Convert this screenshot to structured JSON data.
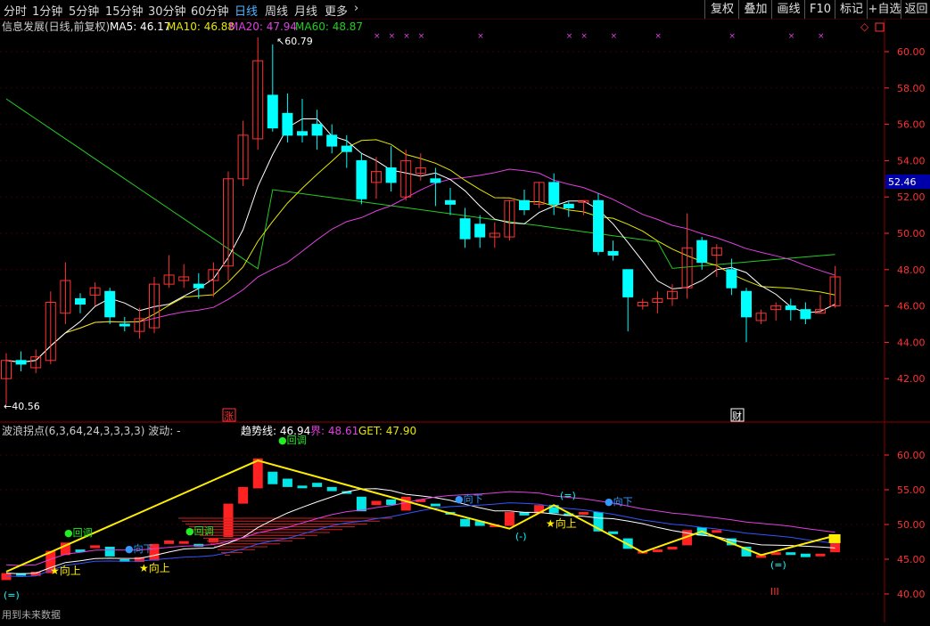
{
  "periods": [
    {
      "label": "分时",
      "active": false
    },
    {
      "label": "1分钟",
      "active": false
    },
    {
      "label": "5分钟",
      "active": false
    },
    {
      "label": "15分钟",
      "active": false
    },
    {
      "label": "30分钟",
      "active": false
    },
    {
      "label": "60分钟",
      "active": false
    },
    {
      "label": "日线",
      "active": true
    },
    {
      "label": "周线",
      "active": false
    },
    {
      "label": "月线",
      "active": false
    },
    {
      "label": "更多",
      "active": false
    }
  ],
  "more_chevron": "›",
  "tools": [
    "复权",
    "叠加",
    "画线",
    "F10",
    "标记",
    "+自选",
    "返回"
  ],
  "main": {
    "title": "信息发展(日线,前复权)",
    "ma5_label": "MA5: 46.17",
    "ma10_label": "MA10: 46.88",
    "ma20_label": "MA20: 47.94",
    "ma60_label": "MA60: 48.87",
    "high_label": "60.79",
    "low_label": "40.56",
    "current_price": "52.46",
    "zhang_marker": "涨",
    "cai_marker": "财",
    "price_axis": [
      "60.00",
      "58.00",
      "56.00",
      "54.00",
      "52.00",
      "50.00",
      "48.00",
      "46.00",
      "44.00",
      "42.00"
    ],
    "x_marker": "×",
    "colors": {
      "ma5": "#ffffff",
      "ma10": "#e6e600",
      "ma20": "#e040e0",
      "ma60": "#22cc22",
      "up": "#ff3333",
      "down": "#00ffff",
      "axis": "#ff3333"
    }
  },
  "sub": {
    "title": "波浪拐点(6,3,64,24,3,3,3,3) 波动: -",
    "trend_label": "趋势线: 46.94",
    "jie_label": "界: 48.61",
    "get_label": "GET: 47.90",
    "axis": [
      "60.00",
      "55.00",
      "50.00",
      "45.00",
      "40.00"
    ],
    "annotations": {
      "huitiao": "回调",
      "xiangxia": "向下",
      "xiangshang": "向上",
      "circle_2": "(=)",
      "circle_1": "(-)",
      "roman": "III"
    },
    "footer": "用到未来数据"
  },
  "chart_data": {
    "type": "candlestick",
    "price_high": 60.79,
    "price_low": 40.56,
    "ylim": [
      40.5,
      61.0
    ],
    "candles": [
      [
        42.0,
        43.0,
        43.4,
        40.6
      ],
      [
        43.0,
        42.8,
        43.5,
        42.4
      ],
      [
        42.6,
        43.2,
        43.6,
        42.3
      ],
      [
        43.0,
        46.2,
        46.8,
        42.8
      ],
      [
        45.6,
        47.4,
        48.4,
        45.0
      ],
      [
        46.4,
        46.1,
        46.7,
        45.6
      ],
      [
        46.6,
        47.0,
        47.3,
        46.0
      ],
      [
        46.8,
        45.4,
        47.0,
        45.0
      ],
      [
        45.0,
        44.9,
        45.4,
        44.6
      ],
      [
        44.6,
        45.3,
        45.9,
        44.2
      ],
      [
        44.8,
        47.2,
        47.6,
        44.5
      ],
      [
        47.2,
        47.7,
        48.8,
        47.0
      ],
      [
        47.4,
        47.6,
        48.3,
        47.0
      ],
      [
        47.2,
        47.0,
        47.8,
        46.4
      ],
      [
        47.4,
        48.0,
        48.4,
        46.5
      ],
      [
        48.2,
        53.0,
        53.4,
        47.4
      ],
      [
        53.0,
        55.4,
        56.2,
        52.6
      ],
      [
        55.2,
        59.5,
        60.79,
        54.6
      ],
      [
        57.6,
        55.8,
        60.4,
        55.6
      ],
      [
        56.6,
        55.4,
        57.7,
        55.0
      ],
      [
        55.6,
        55.4,
        57.4,
        55.0
      ],
      [
        56.0,
        55.4,
        56.8,
        54.6
      ],
      [
        55.4,
        54.8,
        56.0,
        54.4
      ],
      [
        54.8,
        54.5,
        55.4,
        53.6
      ],
      [
        54.0,
        51.9,
        54.4,
        51.6
      ],
      [
        52.8,
        53.4,
        54.2,
        51.9
      ],
      [
        53.6,
        52.8,
        54.8,
        52.3
      ],
      [
        52.0,
        54.0,
        54.6,
        51.8
      ],
      [
        53.3,
        53.6,
        54.4,
        52.9
      ],
      [
        53.0,
        52.8,
        53.6,
        51.5
      ],
      [
        51.8,
        51.6,
        52.5,
        51.0
      ],
      [
        50.8,
        49.7,
        51.4,
        49.2
      ],
      [
        50.5,
        49.8,
        51.0,
        49.2
      ],
      [
        49.8,
        50.0,
        50.6,
        49.2
      ],
      [
        49.8,
        51.8,
        51.8,
        49.6
      ],
      [
        51.8,
        51.3,
        52.4,
        51.0
      ],
      [
        51.6,
        52.8,
        52.8,
        51.4
      ],
      [
        52.8,
        51.6,
        53.3,
        51.0
      ],
      [
        51.6,
        51.4,
        51.8,
        50.9
      ],
      [
        51.7,
        51.8,
        51.8,
        51.0
      ],
      [
        51.8,
        49.0,
        52.2,
        48.8
      ],
      [
        49.0,
        48.8,
        49.6,
        48.5
      ],
      [
        48.0,
        46.5,
        48.0,
        44.6
      ],
      [
        46.0,
        46.2,
        46.4,
        45.8
      ],
      [
        46.2,
        46.4,
        46.8,
        45.6
      ],
      [
        46.4,
        46.8,
        47.2,
        46.0
      ],
      [
        47.0,
        49.2,
        51.1,
        46.4
      ],
      [
        49.6,
        48.4,
        49.8,
        48.0
      ],
      [
        48.8,
        49.2,
        49.4,
        47.6
      ],
      [
        48.0,
        47.0,
        48.6,
        46.6
      ],
      [
        46.8,
        45.4,
        47.0,
        44.0
      ],
      [
        45.2,
        45.6,
        45.8,
        45.0
      ],
      [
        45.8,
        46.0,
        46.2,
        45.2
      ],
      [
        46.0,
        45.8,
        46.4,
        45.2
      ],
      [
        45.8,
        45.3,
        46.2,
        45.0
      ],
      [
        45.6,
        45.8,
        46.6,
        45.6
      ],
      [
        46.0,
        47.6,
        48.2,
        45.9
      ]
    ],
    "wave_points": [
      [
        0,
        43.2
      ],
      [
        17,
        59.2
      ],
      [
        30,
        51.6
      ],
      [
        34,
        49.4
      ],
      [
        37,
        52.8
      ],
      [
        43,
        46.0
      ],
      [
        47,
        49.0
      ],
      [
        51,
        45.6
      ],
      [
        56,
        48.4
      ]
    ]
  }
}
